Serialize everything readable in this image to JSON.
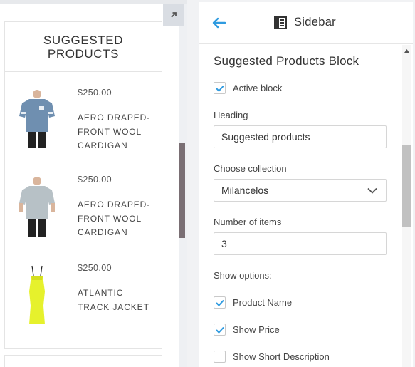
{
  "preview": {
    "block_title": "SUGGESTED PRODUCTS",
    "products": [
      {
        "price": "$250.00",
        "name": "AERO DRAPED-FRONT WOOL CARDIGAN",
        "image": "blue-tshirt"
      },
      {
        "price": "$250.00",
        "name": "AERO DRAPED-FRONT WOOL CARDIGAN",
        "image": "grey-tshirt"
      },
      {
        "price": "$250.00",
        "name": "ATLANTIC TRACK JACKET",
        "image": "yellow-dress"
      }
    ]
  },
  "sidebar": {
    "title": "Sidebar",
    "section_title": "Suggested Products Block",
    "active_block_label": "Active block",
    "active_block_checked": true,
    "heading_label": "Heading",
    "heading_value": "Suggested products",
    "collection_label": "Choose collection",
    "collection_value": "Milancelos",
    "items_label": "Number of items",
    "items_value": "3",
    "show_options_label": "Show options:",
    "options": [
      {
        "label": "Product Name",
        "checked": true
      },
      {
        "label": "Show Price",
        "checked": true
      },
      {
        "label": "Show Short Description",
        "checked": false
      }
    ]
  },
  "colors": {
    "accent": "#2f9be0",
    "scroll_left": "#7a6f74"
  }
}
